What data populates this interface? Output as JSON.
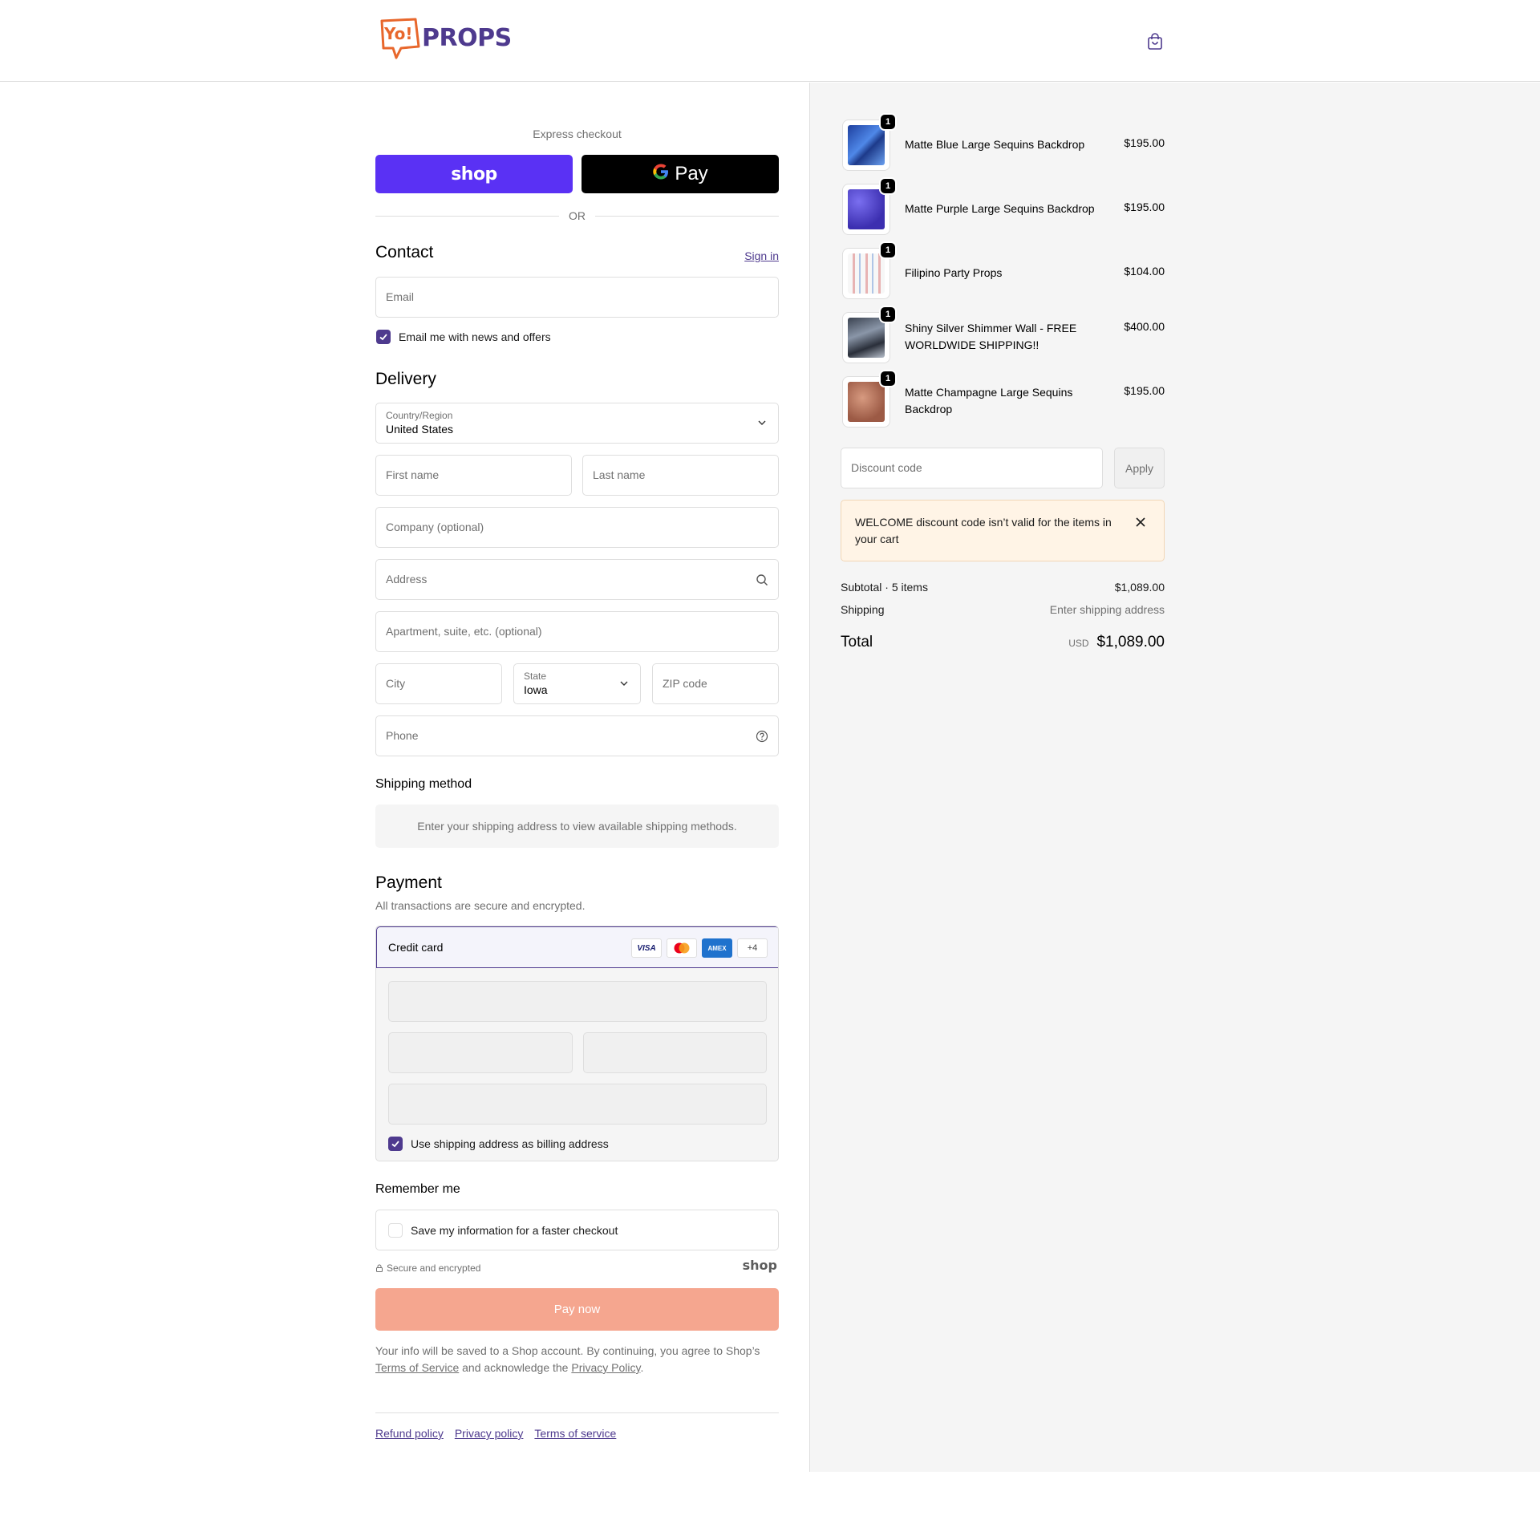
{
  "header": {
    "logo_text": "PROPS",
    "logo_yo": "Yo!"
  },
  "express": {
    "title": "Express checkout",
    "shop_label": "shop",
    "gpay_label": "Pay",
    "or": "OR"
  },
  "contact": {
    "heading": "Contact",
    "sign_in": "Sign in",
    "email_placeholder": "Email",
    "newsletter_label": "Email me with news and offers",
    "newsletter_checked": true
  },
  "delivery": {
    "heading": "Delivery",
    "country_label": "Country/Region",
    "country_value": "United States",
    "first_name": "First name",
    "last_name": "Last name",
    "company": "Company (optional)",
    "address": "Address",
    "apartment": "Apartment, suite, etc. (optional)",
    "city": "City",
    "state_label": "State",
    "state_value": "Iowa",
    "zip": "ZIP code",
    "phone": "Phone"
  },
  "shipping_method": {
    "heading": "Shipping method",
    "message": "Enter your shipping address to view available shipping methods."
  },
  "payment": {
    "heading": "Payment",
    "subtitle": "All transactions are secure and encrypted.",
    "credit_card_label": "Credit card",
    "card_brands": [
      "VISA",
      "MC",
      "AMEX",
      "+4"
    ],
    "billing_label": "Use shipping address as billing address",
    "billing_checked": true
  },
  "remember": {
    "heading": "Remember me",
    "save_label": "Save my information for a faster checkout",
    "secure_label": "Secure and encrypted",
    "shop_brand": "shop"
  },
  "pay_button": "Pay now",
  "terms": {
    "text1": "Your info will be saved to a Shop account. By continuing, you agree to Shop’s",
    "tos_link": "Terms of Service",
    "text2": "and acknowledge the",
    "privacy_link": "Privacy Policy",
    "text3": "."
  },
  "footer": {
    "links": [
      "Refund policy",
      "Privacy policy",
      "Terms of service"
    ]
  },
  "cart": {
    "items": [
      {
        "name": "Matte Blue Large Sequins Backdrop",
        "price": "$195.00",
        "qty": "1"
      },
      {
        "name": "Matte Purple Large Sequins Backdrop",
        "price": "$195.00",
        "qty": "1"
      },
      {
        "name": "Filipino Party Props",
        "price": "$104.00",
        "qty": "1"
      },
      {
        "name": "Shiny Silver Shimmer Wall - FREE WORLDWIDE SHIPPING!!",
        "price": "$400.00",
        "qty": "1"
      },
      {
        "name": "Matte Champagne Large Sequins Backdrop",
        "price": "$195.00",
        "qty": "1"
      }
    ],
    "discount_placeholder": "Discount code",
    "apply_label": "Apply",
    "alert_message": "WELCOME discount code isn’t valid for the items in your cart",
    "subtotal_label": "Subtotal · 5 items",
    "subtotal_value": "$1,089.00",
    "shipping_label": "Shipping",
    "shipping_value": "Enter shipping address",
    "total_label": "Total",
    "currency": "USD",
    "total_value": "$1,089.00"
  },
  "colors": {
    "accent": "#4e3a8e",
    "shop_pay": "#5a31f4",
    "pay_button": "#f5a68f",
    "logo_orange": "#e8672c"
  }
}
